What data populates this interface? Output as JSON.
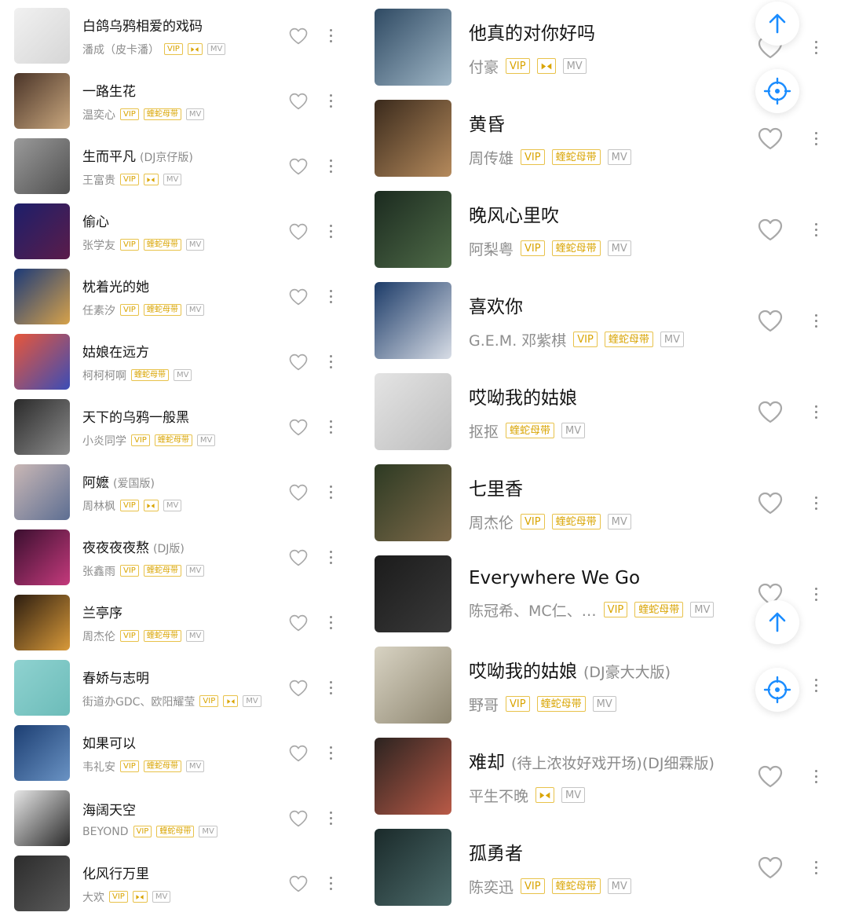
{
  "left_list": [
    {
      "title": "白鸽乌鸦相爱的戏码",
      "suffix": "",
      "artist": "潘成（皮卡潘）",
      "badges": [
        "VIP",
        "Q",
        "MV"
      ],
      "cover": [
        "#f1f1f1",
        "#d6d6d6"
      ]
    },
    {
      "title": "一路生花",
      "suffix": "",
      "artist": "温奕心",
      "badges": [
        "VIP",
        "蝰蛇母带",
        "MV"
      ],
      "cover": [
        "#4a3428",
        "#c9a77e"
      ]
    },
    {
      "title": "生而平凡",
      "suffix": "(DJ京仔版)",
      "artist": "王富贵",
      "badges": [
        "VIP",
        "Q",
        "MV"
      ],
      "cover": [
        "#9a9a9a",
        "#505050"
      ]
    },
    {
      "title": "偷心",
      "suffix": "",
      "artist": "张学友",
      "badges": [
        "VIP",
        "蝰蛇母带",
        "MV"
      ],
      "cover": [
        "#1d1f6a",
        "#5b1c4a"
      ]
    },
    {
      "title": "枕着光的她",
      "suffix": "",
      "artist": "任素汐",
      "badges": [
        "VIP",
        "蝰蛇母带",
        "MV"
      ],
      "cover": [
        "#1c3a78",
        "#d7a24a"
      ]
    },
    {
      "title": "姑娘在远方",
      "suffix": "",
      "artist": "柯柯柯啊",
      "badges": [
        "蝰蛇母带",
        "MV"
      ],
      "cover": [
        "#e7563a",
        "#3b4db6"
      ]
    },
    {
      "title": "天下的乌鸦一般黑",
      "suffix": "",
      "artist": "小炎同学",
      "badges": [
        "VIP",
        "蝰蛇母带",
        "MV"
      ],
      "cover": [
        "#2a2a2a",
        "#8c8c8c"
      ]
    },
    {
      "title": "阿嬷",
      "suffix": "(爱国版)",
      "artist": "周林枫",
      "badges": [
        "VIP",
        "Q",
        "MV"
      ],
      "cover": [
        "#c9b7b5",
        "#5d6e92"
      ]
    },
    {
      "title": "夜夜夜夜熬",
      "suffix": "(DJ版)",
      "artist": "张鑫雨",
      "badges": [
        "VIP",
        "蝰蛇母带",
        "MV"
      ],
      "cover": [
        "#3a0f2f",
        "#c43a7c"
      ]
    },
    {
      "title": "兰亭序",
      "suffix": "",
      "artist": "周杰伦",
      "badges": [
        "VIP",
        "蝰蛇母带",
        "MV"
      ],
      "cover": [
        "#2c1d10",
        "#d99a3a"
      ]
    },
    {
      "title": "春娇与志明",
      "suffix": "",
      "artist": "街道办GDC、欧阳耀莹",
      "badges": [
        "VIP",
        "Q",
        "MV"
      ],
      "cover": [
        "#8fd2d0",
        "#6cbcb9"
      ]
    },
    {
      "title": "如果可以",
      "suffix": "",
      "artist": "韦礼安",
      "badges": [
        "VIP",
        "蝰蛇母带",
        "MV"
      ],
      "cover": [
        "#1c3e72",
        "#6a93c4"
      ]
    },
    {
      "title": "海阔天空",
      "suffix": "",
      "artist": "BEYOND",
      "badges": [
        "VIP",
        "蝰蛇母带",
        "MV"
      ],
      "cover": [
        "#e6e6e6",
        "#2b2b2b"
      ]
    },
    {
      "title": "化风行万里",
      "suffix": "",
      "artist": "大欢",
      "badges": [
        "VIP",
        "Q",
        "MV"
      ],
      "cover": [
        "#2c2c2c",
        "#5a5a5a"
      ]
    }
  ],
  "right_list": [
    {
      "title": "他真的对你好吗",
      "suffix": "",
      "artist": "付豪",
      "badges": [
        "VIP",
        "Q",
        "MV"
      ],
      "cover": [
        "#2f4a63",
        "#9fb6c6"
      ]
    },
    {
      "title": "黄昏",
      "suffix": "",
      "artist": "周传雄",
      "badges": [
        "VIP",
        "蝰蛇母带",
        "MV"
      ],
      "cover": [
        "#3a2a1c",
        "#b58a5c"
      ]
    },
    {
      "title": "晚风心里吹",
      "suffix": "",
      "artist": "阿梨粤",
      "badges": [
        "VIP",
        "蝰蛇母带",
        "MV"
      ],
      "cover": [
        "#1b2a1f",
        "#4f6b48"
      ]
    },
    {
      "title": "喜欢你",
      "suffix": "",
      "artist": "G.E.M. 邓紫棋",
      "badges": [
        "VIP",
        "蝰蛇母带",
        "MV"
      ],
      "cover": [
        "#1c3b68",
        "#d8dde6"
      ]
    },
    {
      "title": "哎呦我的姑娘",
      "suffix": "",
      "artist": "抠抠",
      "badges": [
        "蝰蛇母带",
        "MV"
      ],
      "cover": [
        "#e4e4e4",
        "#bdbdbd"
      ]
    },
    {
      "title": "七里香",
      "suffix": "",
      "artist": "周杰伦",
      "badges": [
        "VIP",
        "蝰蛇母带",
        "MV"
      ],
      "cover": [
        "#2d3a23",
        "#7e6a4a"
      ]
    },
    {
      "title": "Everywhere We Go",
      "suffix": "",
      "artist": "陈冠希、MC仁、…",
      "badges": [
        "VIP",
        "蝰蛇母带",
        "MV"
      ],
      "cover": [
        "#1b1b1b",
        "#3a3a3a"
      ]
    },
    {
      "title": "哎呦我的姑娘",
      "suffix": "(DJ豪大大版)",
      "artist": "野哥",
      "badges": [
        "VIP",
        "蝰蛇母带",
        "MV"
      ],
      "cover": [
        "#d8d3c3",
        "#8e8670"
      ]
    },
    {
      "title": "难却",
      "suffix": "(待上浓妆好戏开场)(DJ细霖版)",
      "artist": "平生不晚",
      "badges": [
        "Q",
        "MV"
      ],
      "cover": [
        "#2b2320",
        "#b95a47"
      ]
    },
    {
      "title": "孤勇者",
      "suffix": "",
      "artist": "陈奕迅",
      "badges": [
        "VIP",
        "蝰蛇母带",
        "MV"
      ],
      "cover": [
        "#1a2a2a",
        "#4d6b6b"
      ]
    }
  ],
  "colors": {
    "accent": "#1a8cff",
    "badge_gold": "#d9a400",
    "text": "#141414",
    "subtext": "#8d8d8d"
  },
  "icons": {
    "like": "heart-outline-icon",
    "more": "vertical-ellipsis-icon",
    "scroll_top": "arrow-up-icon",
    "locate": "crosshair-icon",
    "quality": "bowtie-q-icon"
  }
}
